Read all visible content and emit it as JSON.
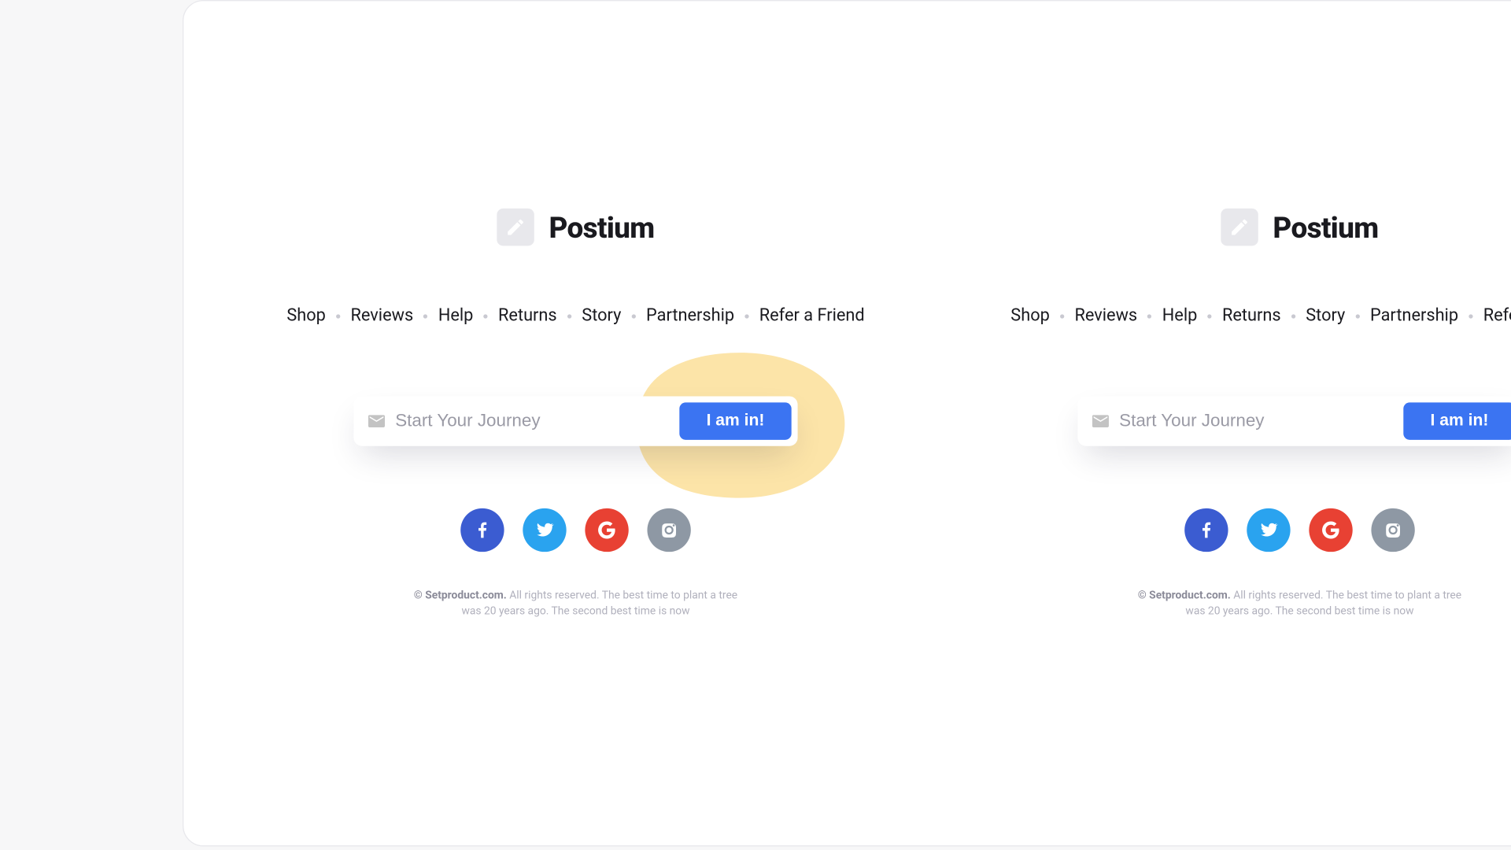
{
  "brand": {
    "name": "Postium"
  },
  "nav": {
    "items": [
      "Shop",
      "Reviews",
      "Help",
      "Returns",
      "Story",
      "Partnership",
      "Refer a Friend"
    ]
  },
  "signup": {
    "placeholder": "Start Your Journey",
    "cta": "I am in!"
  },
  "socials": {
    "facebook": "facebook",
    "twitter": "twitter",
    "google": "google",
    "instagram": "instagram"
  },
  "legal": {
    "prefix": "© Setproduct.com.",
    "rest": " All rights reserved. The best time to plant a tree was 20 years ago. The second best time is now"
  },
  "colors": {
    "accent": "#3b74f2",
    "blob": "#fce4a8",
    "facebook": "#3b5cd1",
    "twitter": "#2aa3ef",
    "google": "#e84133",
    "instagram": "#8e98a4"
  },
  "variants": {
    "left_has_blob": true,
    "right_has_blob": false
  }
}
